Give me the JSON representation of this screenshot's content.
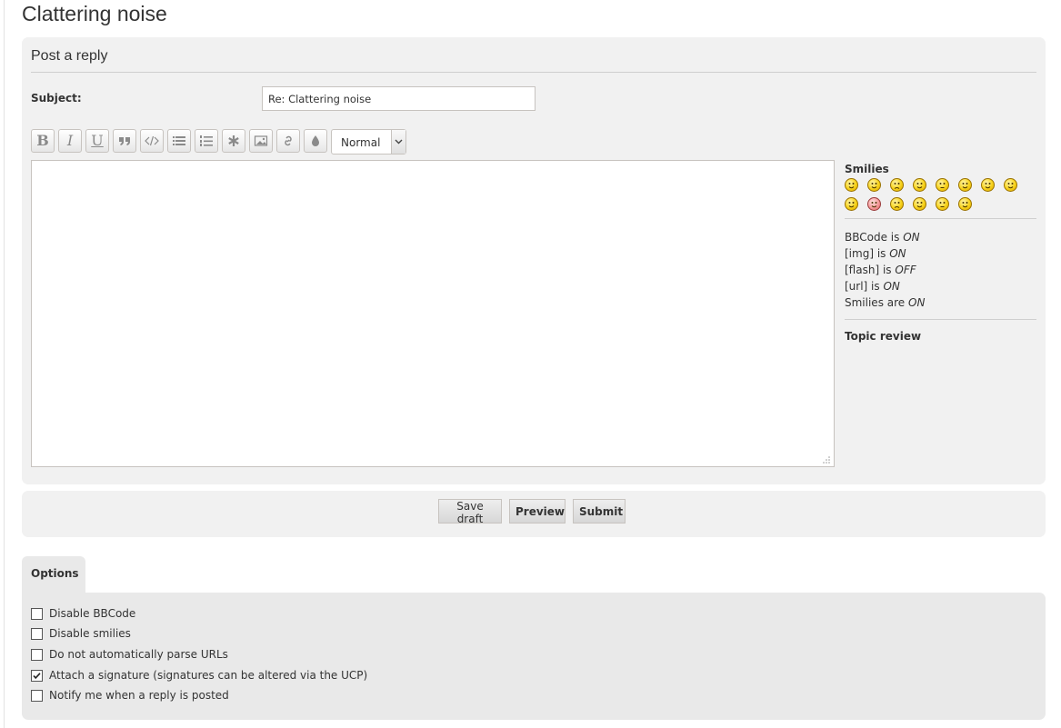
{
  "page": {
    "title": "Clattering noise"
  },
  "post_reply": {
    "heading": "Post a reply",
    "subject_label": "Subject:",
    "subject_value": "Re: Clattering noise"
  },
  "toolbar": {
    "buttons": [
      {
        "name": "bold",
        "icon": "bold-icon",
        "glyph": "B"
      },
      {
        "name": "italic",
        "icon": "italic-icon",
        "glyph": "I"
      },
      {
        "name": "underline",
        "icon": "underline-icon",
        "glyph": "U"
      },
      {
        "name": "quote",
        "icon": "quote-icon"
      },
      {
        "name": "code",
        "icon": "code-icon"
      },
      {
        "name": "list",
        "icon": "list-icon"
      },
      {
        "name": "numbered-list",
        "icon": "numbered-list-icon"
      },
      {
        "name": "list-item",
        "icon": "asterisk-icon"
      },
      {
        "name": "image",
        "icon": "image-icon"
      },
      {
        "name": "link",
        "icon": "link-icon"
      },
      {
        "name": "color",
        "icon": "droplet-icon"
      }
    ],
    "font_size_selected": "Normal"
  },
  "sidebar": {
    "smilies_heading": "Smilies",
    "smilies_count": 14,
    "status": [
      {
        "label": "BBCode is",
        "value": "ON"
      },
      {
        "label": "[img] is",
        "value": "ON"
      },
      {
        "label": "[flash] is",
        "value": "OFF"
      },
      {
        "label": "[url] is",
        "value": "ON"
      },
      {
        "label": "Smilies are",
        "value": "ON"
      }
    ],
    "topic_review": "Topic review"
  },
  "actions": {
    "save_draft": "Save draft",
    "preview": "Preview",
    "submit": "Submit"
  },
  "options": {
    "tab_label": "Options",
    "items": [
      {
        "label": "Disable BBCode",
        "checked": false
      },
      {
        "label": "Disable smilies",
        "checked": false
      },
      {
        "label": "Do not automatically parse URLs",
        "checked": false
      },
      {
        "label": "Attach a signature (signatures can be altered via the UCP)",
        "checked": true
      },
      {
        "label": "Notify me when a reply is posted",
        "checked": false
      }
    ]
  },
  "colors": {
    "panel_bg": "#f1f1f1",
    "options_bg": "#e9e9e9",
    "border": "#c7c3bf",
    "text": "#333333"
  }
}
